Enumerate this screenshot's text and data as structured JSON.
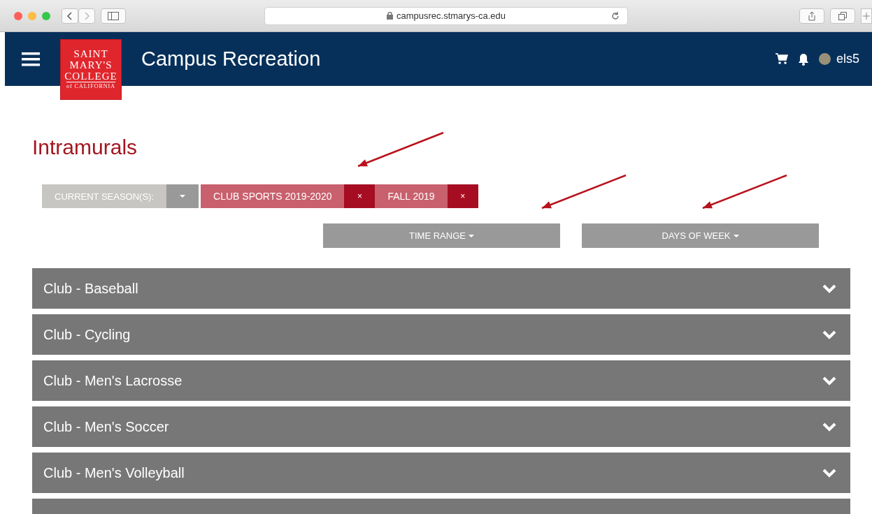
{
  "browser": {
    "url": "campusrec.stmarys-ca.edu"
  },
  "header": {
    "logo_lines": [
      "SAINT",
      "MARY'S",
      "COLLEGE",
      "of CALIFORNIA"
    ],
    "title": "Campus Recreation",
    "user": "els5"
  },
  "page_title": "Intramurals",
  "filters": {
    "season_label": "CURRENT SEASON(S):",
    "chips": [
      {
        "label": "CLUB SPORTS 2019-2020",
        "remove": "×"
      },
      {
        "label": "FALL 2019",
        "remove": "×"
      }
    ],
    "dropdowns": [
      "TIME RANGE",
      "DAYS OF WEEK"
    ]
  },
  "sports": [
    {
      "title": "Club - Baseball",
      "expanded": false
    },
    {
      "title": "Club - Cycling",
      "expanded": false
    },
    {
      "title": "Club - Men's Lacrosse",
      "expanded": false
    },
    {
      "title": "Club - Men's Soccer",
      "expanded": false
    },
    {
      "title": "Club - Men's Volleyball",
      "expanded": false
    }
  ]
}
